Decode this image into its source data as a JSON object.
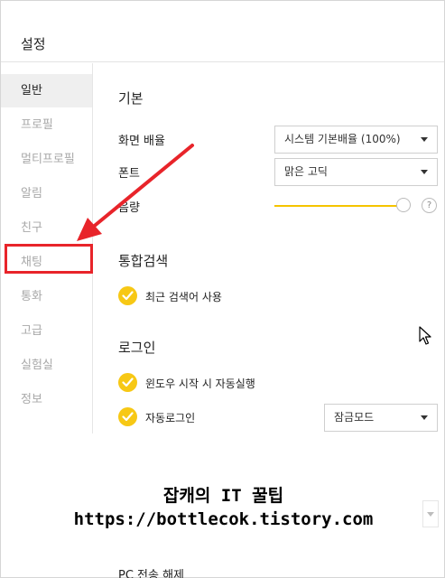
{
  "window": {
    "title": "설정"
  },
  "sidebar": {
    "items": [
      {
        "label": "일반",
        "active": true
      },
      {
        "label": "프로필",
        "active": false
      },
      {
        "label": "멀티프로필",
        "active": false
      },
      {
        "label": "알림",
        "active": false
      },
      {
        "label": "친구",
        "active": false
      },
      {
        "label": "채팅",
        "active": false
      },
      {
        "label": "통화",
        "active": false
      },
      {
        "label": "고급",
        "active": false
      },
      {
        "label": "실험실",
        "active": false
      },
      {
        "label": "정보",
        "active": false
      }
    ]
  },
  "basic": {
    "title": "기본",
    "screen_zoom_label": "화면 배율",
    "screen_zoom_value": "시스템 기본배율 (100%)",
    "font_label": "폰트",
    "font_value": "맑은 고딕",
    "volume_label": "음량",
    "volume_level": 0.95,
    "help_symbol": "?"
  },
  "search": {
    "title": "통합검색",
    "recent_label": "최근 검색어 사용",
    "recent_checked": true
  },
  "login": {
    "title": "로그인",
    "autostart_label": "윈도우 시작 시 자동실행",
    "autostart_checked": true,
    "autologin_label": "자동로그인",
    "autologin_checked": true,
    "lock_mode_value": "잠금모드"
  },
  "watermark": {
    "line1": "잡캐의 IT 꿀팁",
    "line2": "https://bottlecok.tistory.com"
  },
  "cut_off_text": "PC 전송 해제",
  "colors": {
    "accent": "#f7c815",
    "highlight": "#e8242a",
    "active_bg": "#efefef"
  },
  "icons": {
    "check": "check-icon",
    "caret": "chevron-down-icon",
    "cursor": "mouse-cursor-icon",
    "arrow": "red-arrow-annotation"
  }
}
